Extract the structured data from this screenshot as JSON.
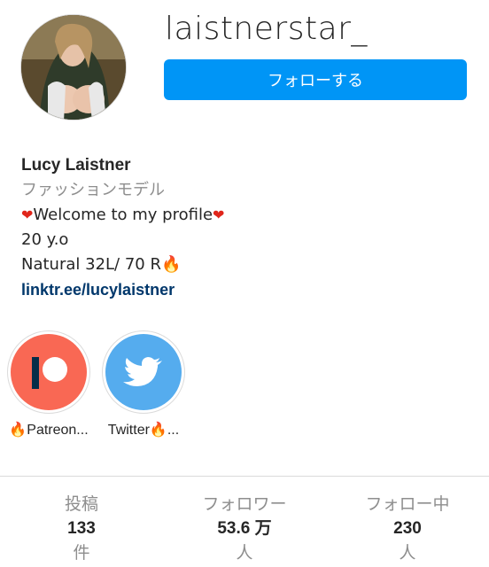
{
  "profile": {
    "username": "laistnerstar_",
    "follow_label": "フォローする"
  },
  "bio": {
    "name": "Lucy Laistner",
    "category": "ファッションモデル",
    "line1": "Welcome to my profile",
    "line2": "20 y.o",
    "line3": "Natural 32L/ 70 R",
    "link": "linktr.ee/lucylaistner"
  },
  "highlights": [
    {
      "label": "Patreon...",
      "icon": "patreon-icon",
      "color": "#f96854"
    },
    {
      "label": "Twitter",
      "icon": "twitter-bird-icon",
      "color": "#55acee"
    }
  ],
  "stats": {
    "posts": {
      "label": "投稿",
      "value": "133",
      "unit": "件"
    },
    "followers": {
      "label": "フォロワー",
      "value": "53.6 万",
      "unit": "人"
    },
    "following": {
      "label": "フォロー中",
      "value": "230",
      "unit": "人"
    }
  },
  "colors": {
    "accent": "#0095f6",
    "link": "#00376b",
    "muted": "#8e8e8e"
  }
}
